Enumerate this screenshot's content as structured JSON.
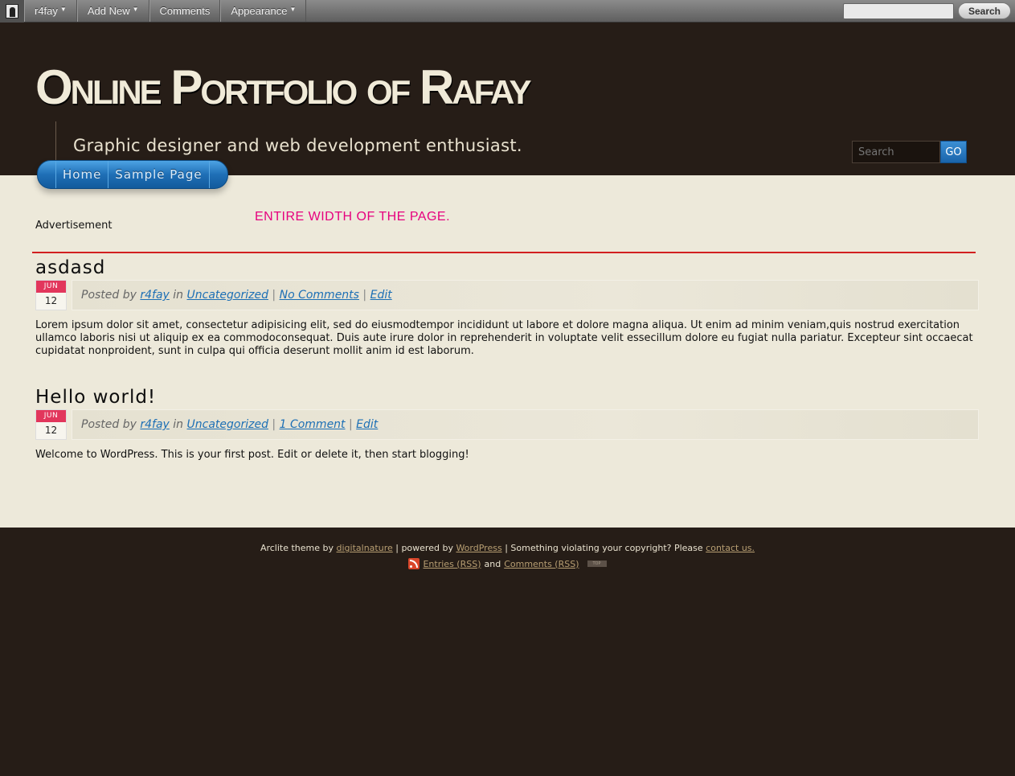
{
  "adminbar": {
    "user_menu": "r4fay",
    "add_new": "Add New",
    "comments": "Comments",
    "appearance": "Appearance",
    "search_placeholder": "",
    "search_button": "Search"
  },
  "header": {
    "site_title": "Online Portfolio of Rafay",
    "tagline": "Graphic designer and web development enthusiast.",
    "search_placeholder": "Search",
    "search_button": "GO"
  },
  "nav": {
    "items": [
      {
        "label": "Home"
      },
      {
        "label": "Sample Page"
      }
    ]
  },
  "main": {
    "advertisement_label": "Advertisement",
    "ad_banner_text": "ENTIRE WIDTH OF THE PAGE.",
    "posts": [
      {
        "title": "asdasd",
        "date_month": "JUN",
        "date_day": "12",
        "posted_by": "Posted by",
        "author": "r4fay",
        "in_word": "in",
        "category": "Uncategorized",
        "comments": "No Comments",
        "edit": "Edit",
        "body": "Lorem ipsum dolor sit amet, consectetur adipisicing elit, sed do eiusmodtempor incididunt ut labore et dolore magna aliqua. Ut enim ad minim veniam,quis nostrud exercitation ullamco laboris nisi ut aliquip ex ea commodoconsequat. Duis aute irure dolor in reprehenderit in voluptate velit essecillum dolore eu fugiat nulla pariatur. Excepteur sint occaecat cupidatat nonproident, sunt in culpa qui officia deserunt mollit anim id est laborum."
      },
      {
        "title": "Hello world!",
        "date_month": "JUN",
        "date_day": "12",
        "posted_by": "Posted by",
        "author": "r4fay",
        "in_word": "in",
        "category": "Uncategorized",
        "comments": "1 Comment",
        "edit": "Edit",
        "body": "Welcome to WordPress. This is your first post. Edit or delete it, then start blogging!"
      }
    ]
  },
  "footer": {
    "theme_text": "Arclite theme by",
    "theme_author": "digitalnature",
    "powered_text": "| powered by",
    "powered_link": "WordPress",
    "copyright_text": "| Something violating your copyright? Please",
    "contact_link": "contact us.",
    "entries_rss": "Entries (RSS)",
    "and_word": "and",
    "comments_rss": "Comments (RSS)",
    "top_label": "TOP"
  },
  "colors": {
    "background_dark": "#261d17",
    "content_bg": "#ede9da",
    "accent_blue": "#1f6fb6",
    "date_red": "#e2365c",
    "rule_red": "#d21f1f",
    "ad_pink": "#e6007e",
    "link_blue": "#1c6fb5"
  },
  "icons": {
    "admin_logo": "user-avatar-icon",
    "rss": "rss-feed-icon"
  }
}
